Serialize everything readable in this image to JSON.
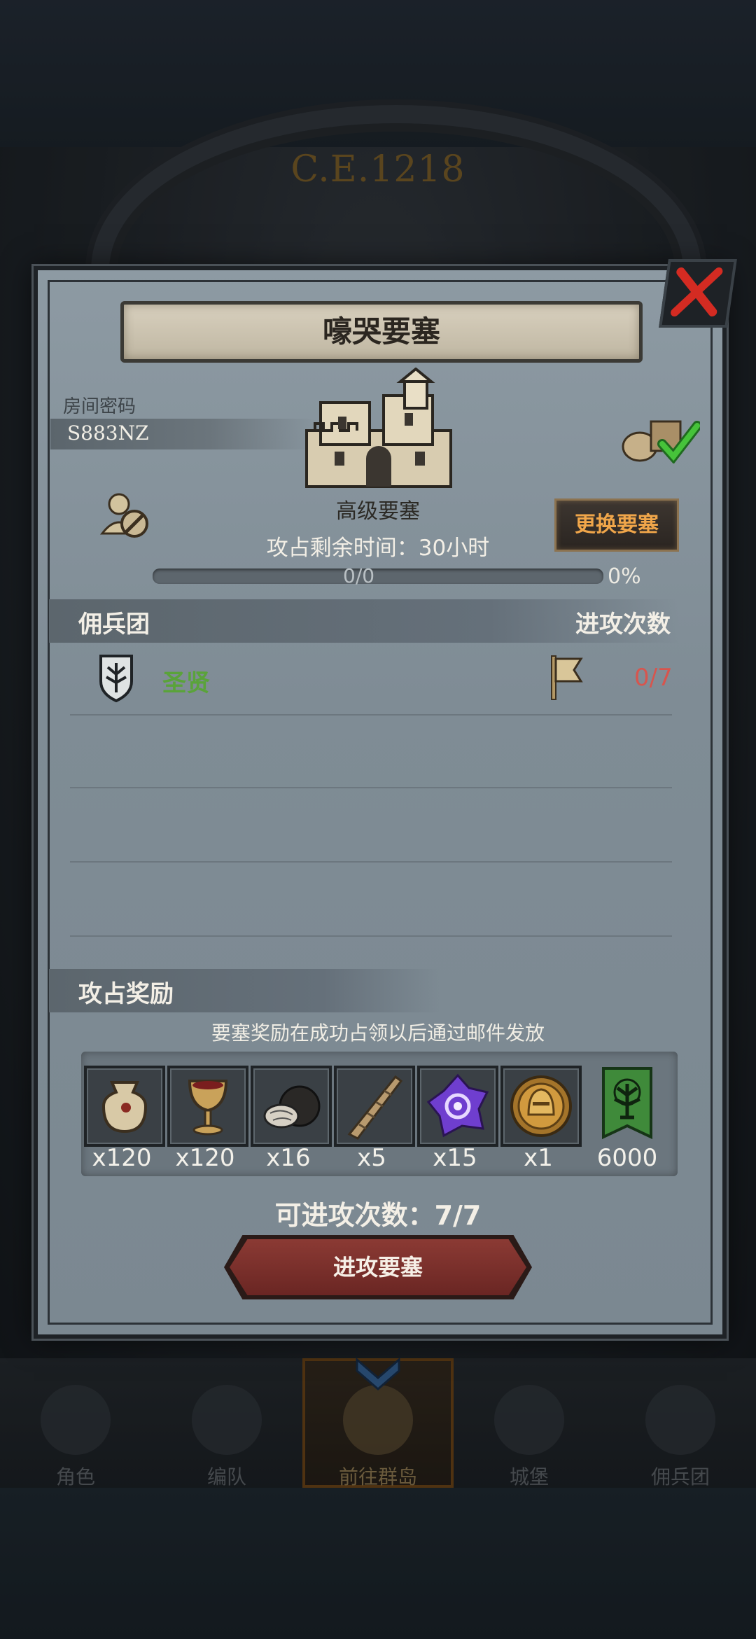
{
  "background": {
    "year": "C.E.1218"
  },
  "dialog": {
    "title": "嚎哭要塞",
    "room_password_label": "房间密码",
    "room_password": "S883NZ",
    "fortress_tier": "高级要塞",
    "change_fortress_button": "更换要塞",
    "time_remaining": "攻占剩余时间：30小时",
    "progress": {
      "count": "0/0",
      "percent": "0%",
      "fraction": 0
    },
    "guild_section_title": "佣兵团",
    "attack_count_header": "进攻次数",
    "guild_rows": [
      {
        "name": "圣贤",
        "attack_count": "0/7"
      }
    ],
    "reward_section_title": "攻占奖励",
    "reward_note": "要塞奖励在成功占领以后通过邮件发放",
    "rewards": [
      {
        "icon": "pouch-icon",
        "qty": "x120"
      },
      {
        "icon": "goblet-icon",
        "qty": "x120"
      },
      {
        "icon": "truffle-icon",
        "qty": "x16"
      },
      {
        "icon": "horn-icon",
        "qty": "x5"
      },
      {
        "icon": "purple-crystal-icon",
        "qty": "x15"
      },
      {
        "icon": "knight-medal-icon",
        "qty": "x1"
      },
      {
        "icon": "guild-banner-icon",
        "qty": "6000"
      }
    ],
    "attacks_remaining": "可进攻次数：7/7",
    "attack_button": "进攻要塞"
  },
  "bottom_nav": [
    {
      "label": "角色",
      "icon": "character-icon"
    },
    {
      "label": "编队",
      "icon": "formation-icon"
    },
    {
      "label": "前往群岛",
      "icon": "archipelago-icon",
      "active": true
    },
    {
      "label": "城堡",
      "icon": "castle-icon"
    },
    {
      "label": "佣兵团",
      "icon": "mercenary-icon"
    }
  ],
  "colors": {
    "guild_name": "#5aa33a",
    "attack_count": "#d7554e",
    "change_button_text": "#f0a64a",
    "attack_button": "#7a2f2a"
  }
}
